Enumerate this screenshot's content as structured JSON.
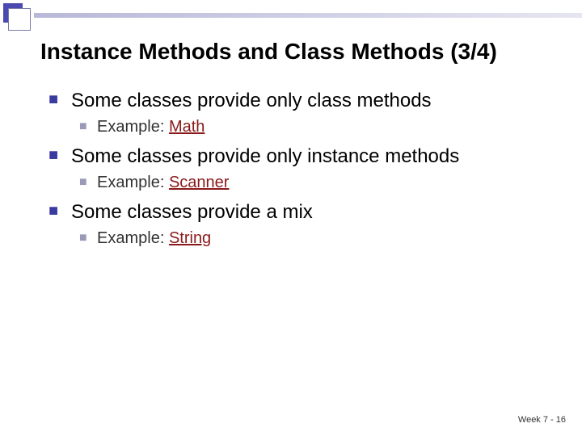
{
  "title": "Instance Methods and Class Methods (3/4)",
  "bullets": [
    {
      "text": "Some classes provide only class methods",
      "sub": {
        "prefix": "Example: ",
        "link": "Math"
      }
    },
    {
      "text": "Some classes provide only instance methods",
      "sub": {
        "prefix": "Example: ",
        "link": "Scanner"
      }
    },
    {
      "text": "Some classes provide a mix",
      "sub": {
        "prefix": "Example: ",
        "link": "String"
      }
    }
  ],
  "footer": "Week 7 - 16"
}
